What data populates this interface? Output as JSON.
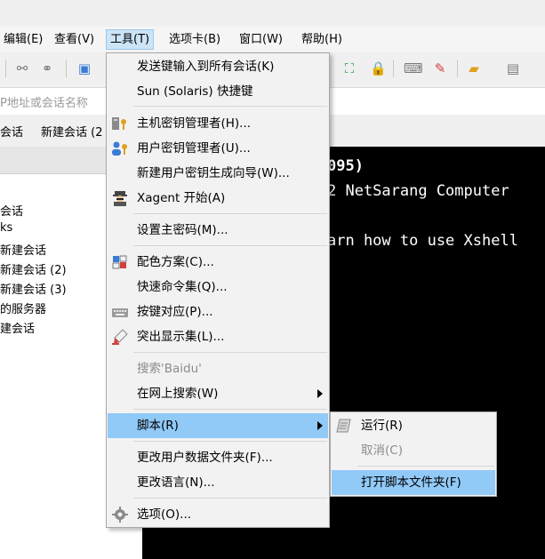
{
  "menubar": {
    "items": [
      {
        "label": "编辑(E)"
      },
      {
        "label": "查看(V)"
      },
      {
        "label": "工具(T)"
      },
      {
        "label": "选项卡(B)"
      },
      {
        "label": "窗口(W)"
      },
      {
        "label": "帮助(H)"
      }
    ]
  },
  "addressbar": {
    "placeholder": "P地址或会话名称"
  },
  "tabs": [
    {
      "label": "会话"
    },
    {
      "label": "新建会话 (2"
    }
  ],
  "session_tree": {
    "items": [
      {
        "label": "会话"
      },
      {
        "label": "ks"
      },
      {
        "label": "新建会话"
      },
      {
        "label": "新建会话 (2)"
      },
      {
        "label": "新建会话 (3)"
      },
      {
        "label": "的服务器"
      },
      {
        "label": "建会话"
      }
    ]
  },
  "terminal": {
    "lines": [
      "095)",
      "2 NetSarang Computer",
      "arn how to use Xshell"
    ]
  },
  "tools_menu": {
    "items": [
      {
        "label": "发送键输入到所有会话(K)",
        "icon": ""
      },
      {
        "label": "Sun (Solaris) 快捷键",
        "icon": ""
      },
      {
        "label": "主机密钥管理者(H)...",
        "icon": "host-key-icon"
      },
      {
        "label": "用户密钥管理者(U)...",
        "icon": "user-key-icon"
      },
      {
        "label": "新建用户密钥生成向导(W)...",
        "icon": ""
      },
      {
        "label": "Xagent 开始(A)",
        "icon": "agent-icon"
      },
      {
        "label": "设置主密码(M)...",
        "icon": ""
      },
      {
        "label": "配色方案(C)...",
        "icon": "color-scheme-icon"
      },
      {
        "label": "快速命令集(Q)...",
        "icon": ""
      },
      {
        "label": "按键对应(P)...",
        "icon": "keyboard-icon"
      },
      {
        "label": "突出显示集(L)...",
        "icon": "highlighter-icon"
      },
      {
        "label": "搜索'Baidu'",
        "icon": ""
      },
      {
        "label": "在网上搜索(W)",
        "icon": ""
      },
      {
        "label": "脚本(R)",
        "icon": ""
      },
      {
        "label": "更改用户数据文件夹(F)...",
        "icon": ""
      },
      {
        "label": "更改语言(N)...",
        "icon": ""
      },
      {
        "label": "选项(O)...",
        "icon": "gear-icon"
      }
    ]
  },
  "script_submenu": {
    "items": [
      {
        "label": "运行(R)",
        "icon": "script-icon"
      },
      {
        "label": "取消(C)"
      },
      {
        "label": "打开脚本文件夹(F)"
      }
    ]
  },
  "colors": {
    "highlight": "#91c9f7",
    "menu_bg": "#f2f2f2",
    "terminal_bg": "#000000"
  }
}
